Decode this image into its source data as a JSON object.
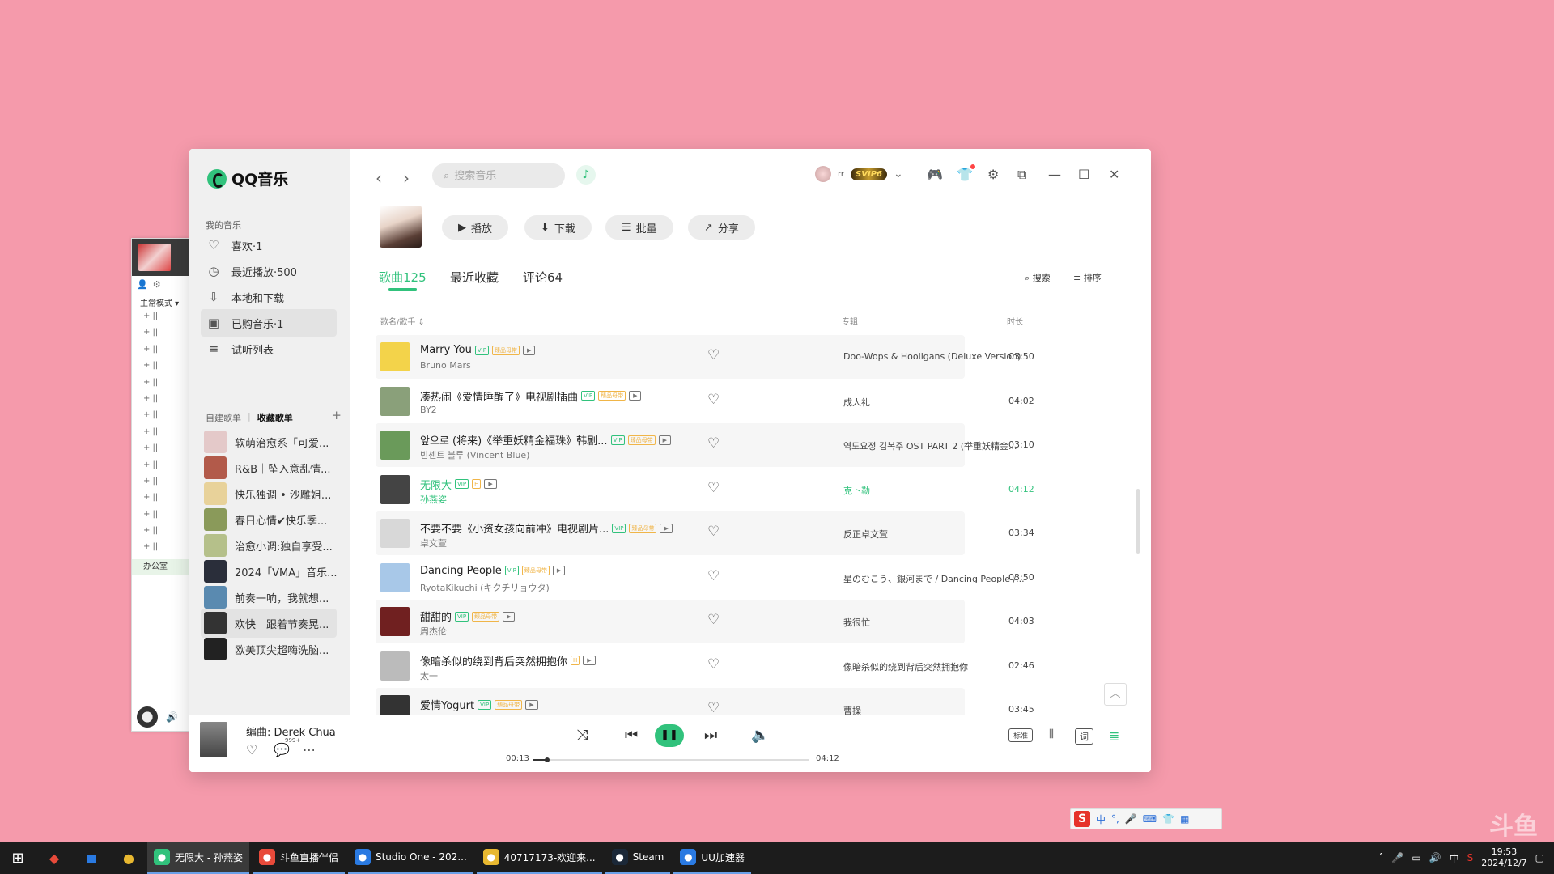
{
  "colors": {
    "accent": "#31c27c",
    "desktop": "#f59aab",
    "vip": "#c49a2c"
  },
  "bgwin": {
    "mode": "主常模式 ▾",
    "group": "办公室",
    "rows": [
      "+ ||",
      "+ ||",
      "+ ||",
      "+ ||",
      "+ ||",
      "+ ||",
      "+ ||",
      "+ ||",
      "+ ||",
      "+ ||",
      "+ ||",
      "+ ||",
      "+ ||",
      "+ ||",
      "+ ||"
    ]
  },
  "app": {
    "logo": "QQ音乐"
  },
  "sidebar": {
    "section_title": "我的音乐",
    "items": [
      {
        "label": "喜欢·1",
        "icon": "heart-icon"
      },
      {
        "label": "最近播放·500",
        "icon": "clock-icon"
      },
      {
        "label": "本地和下载",
        "icon": "download-icon"
      },
      {
        "label": "已购音乐·1",
        "icon": "bag-icon"
      },
      {
        "label": "试听列表",
        "icon": "list-icon"
      }
    ],
    "tab_created": "自建歌单",
    "tab_collected": "收藏歌单",
    "playlists": [
      "软萌治愈系「可爱...",
      "R&B｜坠入意乱情...",
      "快乐独调 • 沙雕姐...",
      "春日心情✔快乐季...",
      "治愈小调:独自享受...",
      "2024「VMA」音乐...",
      "前奏一响，我就想...",
      "欢快｜跟着节奏晃...",
      "欧美顶尖超嗨洗脑..."
    ]
  },
  "topbar": {
    "search_placeholder": "搜索音乐",
    "username": "rr",
    "vip_badge": "SVIP6"
  },
  "header": {
    "buttons": {
      "play": "播放",
      "download": "下载",
      "batch": "批量",
      "share": "分享"
    },
    "tabs": [
      "歌曲125",
      "最近收藏",
      "评论64"
    ],
    "search_label": "搜索",
    "sort_label": "排序"
  },
  "table": {
    "col_song": "歌名/歌手 ⇕",
    "col_album": "专辑",
    "col_duration": "时长",
    "rows": [
      {
        "title": "Marry You",
        "artist": "Bruno Mars",
        "album": "Doo-Wops & Hooligans (Deluxe Version)",
        "duration": "03:50",
        "vip": "VIP",
        "hq": "臻品母带",
        "mv": "▶"
      },
      {
        "title": "凑热闹《爱情睡醒了》电视剧插曲",
        "artist": "BY2",
        "album": "成人礼",
        "duration": "04:02",
        "vip": "VIP",
        "hq": "臻品母带",
        "mv": "▶"
      },
      {
        "title": "앞으로 (将来)《举重妖精金福珠》韩剧...",
        "artist": "빈센트 블루 (Vincent Blue)",
        "album": "역도요정 김복주 OST PART 2 (举重妖精金...",
        "duration": "03:10",
        "vip": "VIP",
        "hq": "臻品母带",
        "mv": "▶"
      },
      {
        "title": "无限大",
        "artist": "孙燕姿",
        "album": "克卜勒",
        "duration": "04:12",
        "vip": "VIP",
        "hq": "H",
        "mv": "▶"
      },
      {
        "title": "不要不要《小资女孩向前冲》电视剧片...",
        "artist": "卓文萱",
        "album": "反正卓文萱",
        "duration": "03:34",
        "vip": "VIP",
        "hq": "臻品母带",
        "mv": "▶"
      },
      {
        "title": "Dancing People",
        "artist": "RyotaKikuchi (キクチリョウタ)",
        "album": "星のむこう、銀河まで / Dancing People /...",
        "duration": "03:50",
        "vip": "VIP",
        "hq": "臻品母带",
        "mv": "▶"
      },
      {
        "title": "甜甜的",
        "artist": "周杰伦",
        "album": "我很忙",
        "duration": "04:03",
        "vip": "VIP",
        "hq": "臻品母带",
        "mv": "▶"
      },
      {
        "title": "像暗杀似的绕到背后突然拥抱你",
        "artist": "太一",
        "album": "像暗杀似的绕到背后突然拥抱你",
        "duration": "02:46",
        "vip": "",
        "hq": "H",
        "mv": "▶"
      },
      {
        "title": "爱情Yogurt",
        "artist": "",
        "album": "曹操",
        "duration": "03:45",
        "vip": "VIP",
        "hq": "臻品母带",
        "mv": "▶"
      }
    ]
  },
  "player": {
    "info": "编曲:  Derek Chua",
    "comment_count": "999+",
    "elapsed": "00:13",
    "total": "04:12",
    "progress": 0.052,
    "quality": "标准",
    "lyric": "词"
  },
  "ime": {
    "mode": "中"
  },
  "watermark": "斗鱼",
  "taskbar": {
    "apps": [
      {
        "label": "无限大 - 孙燕姿",
        "icon": "qq-music-icon",
        "color": "#31c27c",
        "active": true
      },
      {
        "label": "斗鱼直播伴侣",
        "icon": "douyu-icon",
        "color": "#e84a3a",
        "active": false
      },
      {
        "label": "Studio One - 202...",
        "icon": "studio-one-icon",
        "color": "#2a7ae2",
        "active": false
      },
      {
        "label": "40717173-欢迎来...",
        "icon": "owl-icon",
        "color": "#e8b830",
        "active": false
      },
      {
        "label": "Steam",
        "icon": "steam-icon",
        "color": "#1b2838",
        "active": false
      },
      {
        "label": "UU加速器",
        "icon": "uu-icon",
        "color": "#2a7ae2",
        "active": false
      }
    ],
    "ime": "中",
    "time": "19:53",
    "date": "2024/12/7"
  }
}
